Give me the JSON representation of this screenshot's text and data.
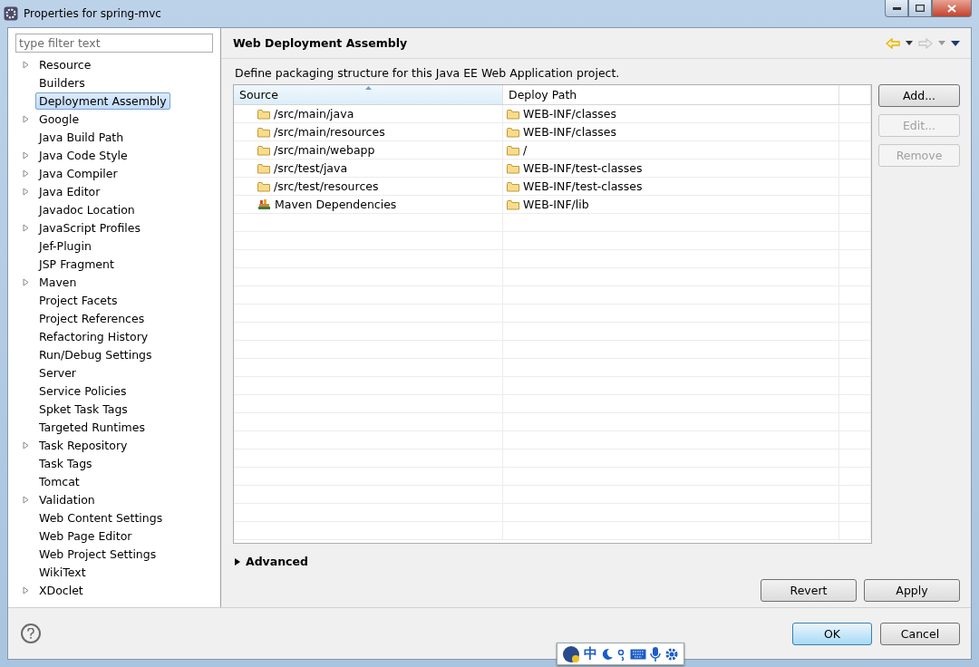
{
  "window": {
    "title": "Properties for spring-mvc"
  },
  "filter": {
    "placeholder": "type filter text"
  },
  "sidebar": {
    "items": [
      {
        "label": "Resource",
        "expandable": true,
        "selected": false
      },
      {
        "label": "Builders",
        "expandable": false,
        "selected": false
      },
      {
        "label": "Deployment Assembly",
        "expandable": false,
        "selected": true
      },
      {
        "label": "Google",
        "expandable": true,
        "selected": false
      },
      {
        "label": "Java Build Path",
        "expandable": false,
        "selected": false
      },
      {
        "label": "Java Code Style",
        "expandable": true,
        "selected": false
      },
      {
        "label": "Java Compiler",
        "expandable": true,
        "selected": false
      },
      {
        "label": "Java Editor",
        "expandable": true,
        "selected": false
      },
      {
        "label": "Javadoc Location",
        "expandable": false,
        "selected": false
      },
      {
        "label": "JavaScript Profiles",
        "expandable": true,
        "selected": false
      },
      {
        "label": "Jef-Plugin",
        "expandable": false,
        "selected": false
      },
      {
        "label": "JSP Fragment",
        "expandable": false,
        "selected": false
      },
      {
        "label": "Maven",
        "expandable": true,
        "selected": false
      },
      {
        "label": "Project Facets",
        "expandable": false,
        "selected": false
      },
      {
        "label": "Project References",
        "expandable": false,
        "selected": false
      },
      {
        "label": "Refactoring History",
        "expandable": false,
        "selected": false
      },
      {
        "label": "Run/Debug Settings",
        "expandable": false,
        "selected": false
      },
      {
        "label": "Server",
        "expandable": false,
        "selected": false
      },
      {
        "label": "Service Policies",
        "expandable": false,
        "selected": false
      },
      {
        "label": "Spket Task Tags",
        "expandable": false,
        "selected": false
      },
      {
        "label": "Targeted Runtimes",
        "expandable": false,
        "selected": false
      },
      {
        "label": "Task Repository",
        "expandable": true,
        "selected": false
      },
      {
        "label": "Task Tags",
        "expandable": false,
        "selected": false
      },
      {
        "label": "Tomcat",
        "expandable": false,
        "selected": false
      },
      {
        "label": "Validation",
        "expandable": true,
        "selected": false
      },
      {
        "label": "Web Content Settings",
        "expandable": false,
        "selected": false
      },
      {
        "label": "Web Page Editor",
        "expandable": false,
        "selected": false
      },
      {
        "label": "Web Project Settings",
        "expandable": false,
        "selected": false
      },
      {
        "label": "WikiText",
        "expandable": false,
        "selected": false
      },
      {
        "label": "XDoclet",
        "expandable": true,
        "selected": false
      }
    ]
  },
  "page": {
    "title": "Web Deployment Assembly",
    "nav": [
      {
        "kind": "back",
        "disabled": false
      },
      {
        "kind": "forward",
        "disabled": true
      }
    ],
    "description": "Define packaging structure for this Java EE Web Application project.",
    "table": {
      "columns": [
        {
          "label": "Source",
          "sorted": true
        },
        {
          "label": "Deploy Path",
          "sorted": false
        }
      ],
      "rows": [
        {
          "kind": "folder",
          "source": "/src/main/java",
          "deploy_path": "WEB-INF/classes"
        },
        {
          "kind": "folder",
          "source": "/src/main/resources",
          "deploy_path": "WEB-INF/classes"
        },
        {
          "kind": "folder",
          "source": "/src/main/webapp",
          "deploy_path": "/"
        },
        {
          "kind": "folder",
          "source": "/src/test/java",
          "deploy_path": "WEB-INF/test-classes"
        },
        {
          "kind": "folder",
          "source": "/src/test/resources",
          "deploy_path": "WEB-INF/test-classes"
        },
        {
          "kind": "library",
          "source": "Maven Dependencies",
          "deploy_path": "WEB-INF/lib"
        }
      ]
    },
    "side_buttons": [
      {
        "label": "Add...",
        "disabled": false
      },
      {
        "label": "Edit...",
        "disabled": true
      },
      {
        "label": "Remove",
        "disabled": true
      }
    ],
    "advanced": {
      "label": "Advanced",
      "expanded": false
    },
    "buttons": [
      "Revert",
      "Apply"
    ]
  },
  "dialog_buttons": [
    {
      "label": "OK",
      "default": true
    },
    {
      "label": "Cancel",
      "default": false
    }
  ],
  "ime_bar": {
    "mode": "中"
  }
}
